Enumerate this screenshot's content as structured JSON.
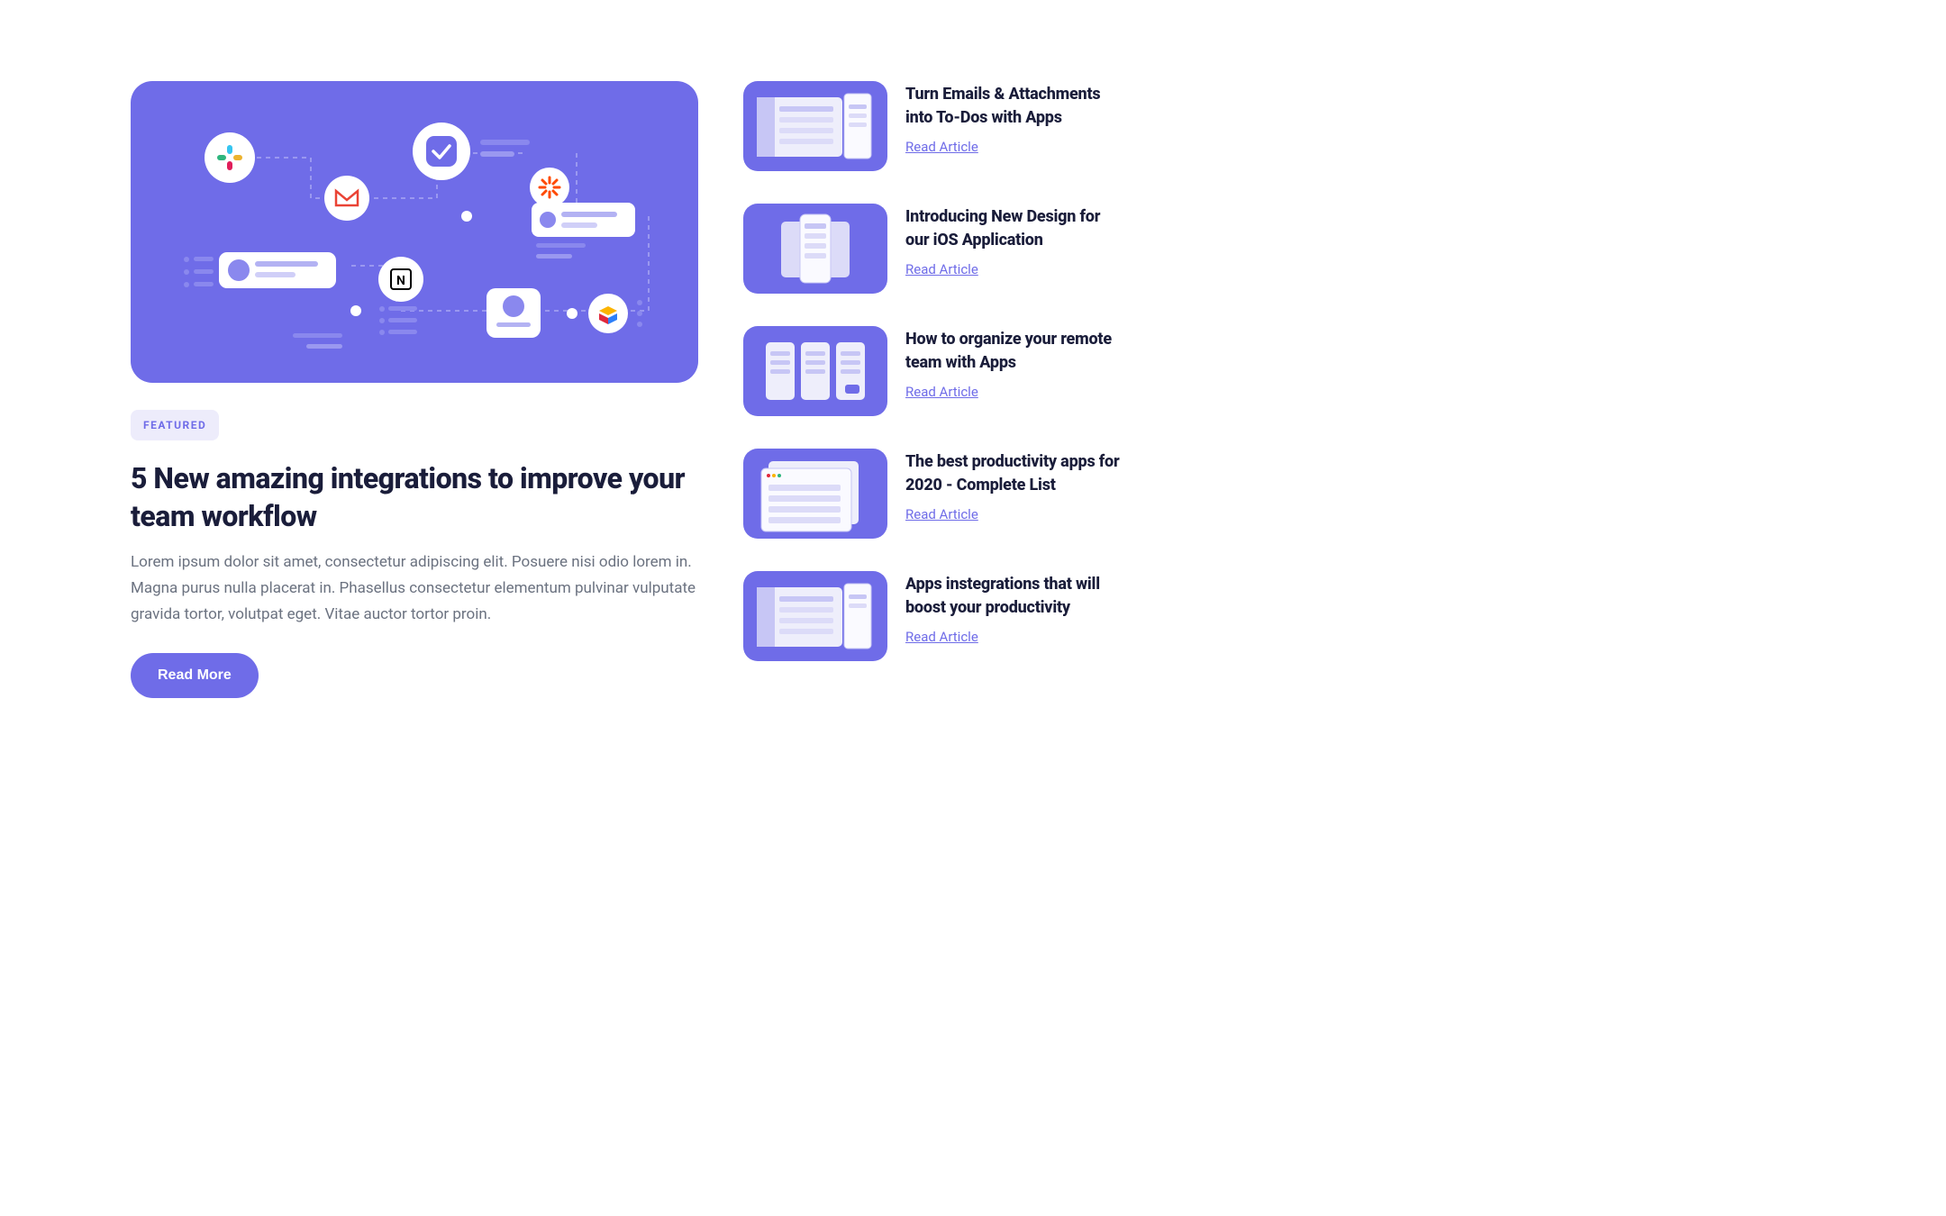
{
  "featured": {
    "badge": "FEATURED",
    "title": "5 New amazing integrations to improve your team workflow",
    "description": "Lorem ipsum dolor sit amet, consectetur adipiscing elit. Posuere nisi odio lorem in. Magna purus nulla placerat in. Phasellus consectetur elementum pulvinar vulputate gravida tortor, volutpat eget. Vitae auctor tortor proin.",
    "button_label": "Read More"
  },
  "sidebar": {
    "items": [
      {
        "title": "Turn Emails & Attachments into To-Dos with Apps",
        "link_label": "Read Article"
      },
      {
        "title": "Introducing New Design for our iOS Application",
        "link_label": "Read Article"
      },
      {
        "title": "How to organize your remote team with Apps",
        "link_label": "Read Article"
      },
      {
        "title": "The best productivity apps for 2020 - Complete List",
        "link_label": "Read Article"
      },
      {
        "title": "Apps instegrations that will boost your productivity",
        "link_label": "Read Article"
      }
    ]
  },
  "icons": {
    "hero": [
      "slack-icon",
      "gmail-icon",
      "notion-icon",
      "check-icon",
      "zapier-icon",
      "airtable-icon"
    ]
  },
  "colors": {
    "accent": "#6f6ce8",
    "badge_bg": "#edecfb",
    "text_dark": "#1a1d3a",
    "text_muted": "#6b7280"
  }
}
